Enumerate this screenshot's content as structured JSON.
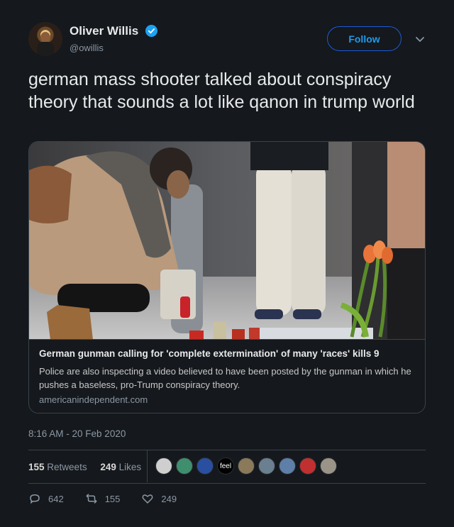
{
  "author": {
    "name": "Oliver Willis",
    "handle": "@owillis",
    "verified": true,
    "follow_label": "Follow"
  },
  "tweet": {
    "text": "german mass shooter talked about conspiracy theory that sounds a lot like qanon in trump world",
    "timestamp": "8:16 AM - 20 Feb 2020"
  },
  "card": {
    "title": "German gunman calling for 'complete extermination' of many 'races' kills 9",
    "description": "Police are also inspecting a video believed to have been posted by the gunman in which he pushes a baseless, pro-Trump conspiracy theory.",
    "domain": "americanindependent.com"
  },
  "stats": {
    "retweets_count": "155",
    "retweets_label": "Retweets",
    "likes_count": "249",
    "likes_label": "Likes"
  },
  "likers": [
    {
      "color": "#cfcfcf"
    },
    {
      "color": "#3f8f6f"
    },
    {
      "color": "#2a4fa0"
    },
    {
      "color": "#000000",
      "text": "feel"
    },
    {
      "color": "#8a7a5a"
    },
    {
      "color": "#6a7f90"
    },
    {
      "color": "#5e7fa8"
    },
    {
      "color": "#c03030"
    },
    {
      "color": "#9a9488"
    }
  ],
  "actions": {
    "replies": "642",
    "retweets": "155",
    "likes": "249"
  },
  "colors": {
    "accent": "#1d9bf0",
    "background": "#15181c",
    "border": "#38444d"
  }
}
